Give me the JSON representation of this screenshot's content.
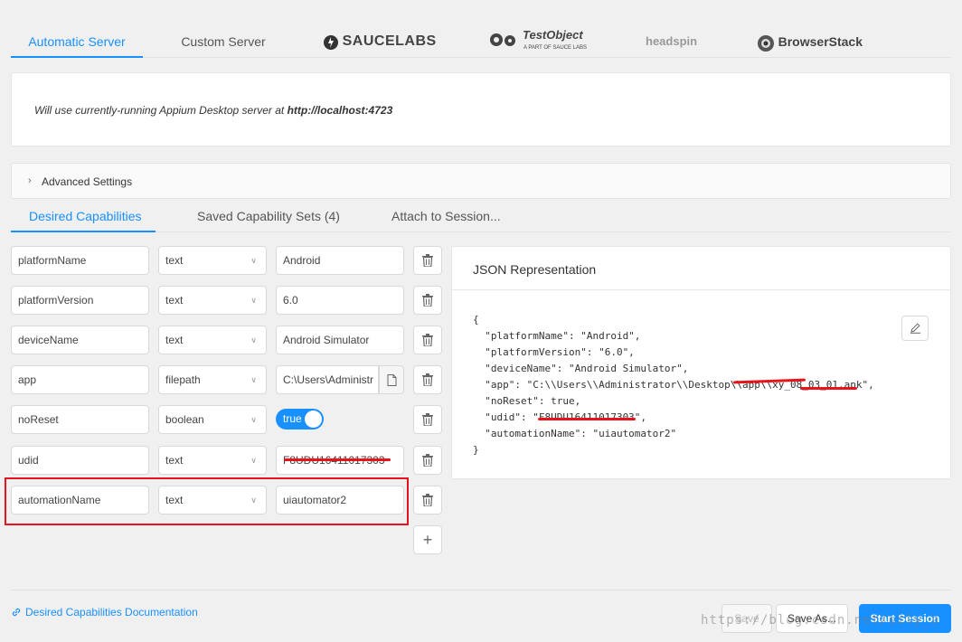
{
  "server_tabs": {
    "automatic": "Automatic Server",
    "custom": "Custom Server",
    "saucelabs": "SAUCELABS",
    "testobject": "TestObject",
    "testobject_sub": "A PART OF SAUCE LABS",
    "headspin": "headspin",
    "browserstack": "BrowserStack"
  },
  "server_panel": {
    "message": "Will use currently-running Appium Desktop server at ",
    "url": "http://localhost:4723"
  },
  "advanced": {
    "label": "Advanced Settings"
  },
  "cap_tabs": {
    "desired": "Desired Capabilities",
    "saved": "Saved Capability Sets (4)",
    "attach": "Attach to Session..."
  },
  "capabilities": [
    {
      "name": "platformName",
      "type": "text",
      "value": "Android"
    },
    {
      "name": "platformVersion",
      "type": "text",
      "value": "6.0"
    },
    {
      "name": "deviceName",
      "type": "text",
      "value": "Android Simulator"
    },
    {
      "name": "app",
      "type": "filepath",
      "value": "C:\\Users\\Administr"
    },
    {
      "name": "noReset",
      "type": "boolean",
      "value": "true"
    },
    {
      "name": "udid",
      "type": "text",
      "value": "F8UDU16411017303"
    },
    {
      "name": "automationName",
      "type": "text",
      "value": "uiautomator2"
    }
  ],
  "json_panel": {
    "title": "JSON Representation",
    "body": "{\n  \"platformName\": \"Android\",\n  \"platformVersion\": \"6.0\",\n  \"deviceName\": \"Android Simulator\",\n  \"app\": \"C:\\\\Users\\\\Administrator\\\\Desktop\\\\app\\\\xy_08_03_01.apk\",\n  \"noReset\": true,\n  \"udid\": \"F8UDU16411017303\",\n  \"automationName\": \"uiautomator2\"\n}"
  },
  "footer": {
    "doc_link": "Desired Capabilities Documentation",
    "save": "Save",
    "save_as": "Save As...",
    "start": "Start Session",
    "watermark": "https://blog.csdn.net/sily_z"
  },
  "colors": {
    "accent": "#1890ff",
    "highlight": "#e8141c"
  }
}
